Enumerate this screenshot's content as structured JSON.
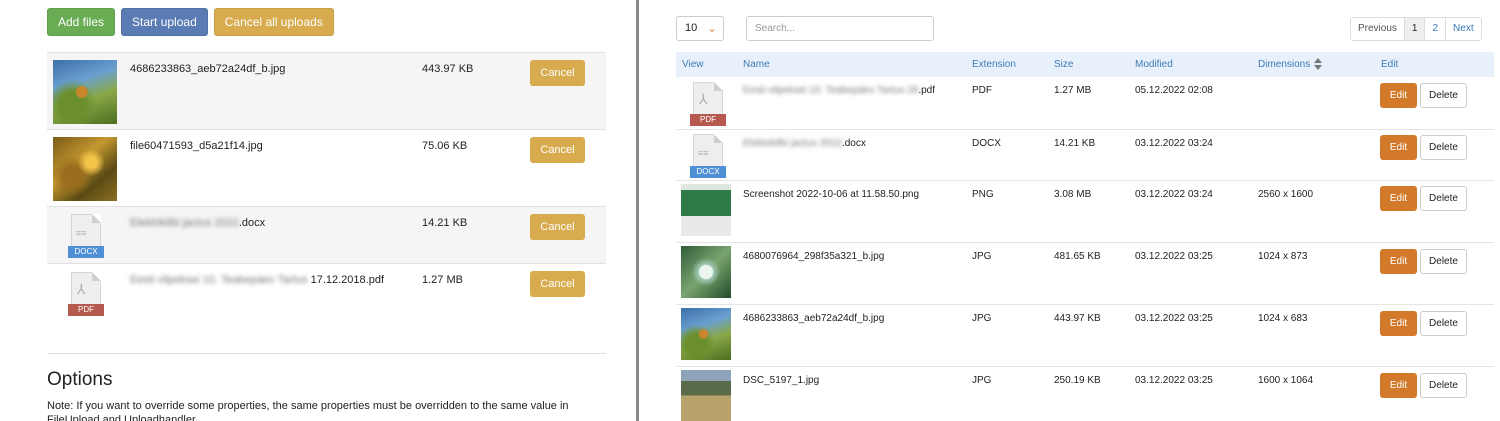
{
  "upload_panel": {
    "buttons": {
      "add_files": "Add files",
      "start_upload": "Start upload",
      "cancel_all": "Cancel all uploads"
    },
    "files": [
      {
        "name": "4686233863_aeb72a24df_b.jpg",
        "size": "443.97 KB",
        "thumb": "photo-bird"
      },
      {
        "name": "file60471593_d5a21f14.jpg",
        "size": "75.06 KB",
        "thumb": "photo-leaves"
      },
      {
        "name_blurred": "Elektrikilbi jactus 2022",
        "name_visible": ".docx",
        "size": "14.21 KB",
        "thumb": "docx-icon"
      },
      {
        "name_blurred": "Eesti vilpeksei 10. Teabepäev Tartus",
        "name_visible": " 17.12.2018.pdf",
        "size": "1.27 MB",
        "thumb": "pdf-icon"
      }
    ],
    "cancel_label": "Cancel",
    "options_title": "Options",
    "options_note": "Note: If you want to override some properties, the same properties must be overridden to the same value in FileUpload and Uploadhandler."
  },
  "file_table": {
    "page_length": "10",
    "search_placeholder": "Search...",
    "pagination": {
      "previous": "Previous",
      "pages": [
        "1",
        "2"
      ],
      "next": "Next",
      "active_page": "1"
    },
    "columns": {
      "view": "View",
      "name": "Name",
      "extension": "Extension",
      "size": "Size",
      "modified": "Modified",
      "dimensions": "Dimensions",
      "edit": "Edit"
    },
    "rows": [
      {
        "name_blurred": "Eesti vilpeksei 10. Teabepäev Tartus 28",
        "name_visible": ".pdf",
        "extension": "PDF",
        "size": "1.27 MB",
        "modified": "05.12.2022 02:08",
        "dimensions": "",
        "thumb": "pdf-icon"
      },
      {
        "name_blurred": "Elektrikilbi jactus 2022",
        "name_visible": ".docx",
        "extension": "DOCX",
        "size": "14.21 KB",
        "modified": "03.12.2022 03:24",
        "dimensions": "",
        "thumb": "docx-icon"
      },
      {
        "name": "Screenshot 2022-10-06 at 11.58.50.png",
        "extension": "PNG",
        "size": "3.08 MB",
        "modified": "03.12.2022 03:24",
        "dimensions": "2560 x 1600",
        "thumb": "photo-screenshot"
      },
      {
        "name": "4680076964_298f35a321_b.jpg",
        "extension": "JPG",
        "size": "481.65 KB",
        "modified": "03.12.2022 03:25",
        "dimensions": "1024 x 873",
        "thumb": "photo-bubble"
      },
      {
        "name": "4686233863_aeb72a24df_b.jpg",
        "extension": "JPG",
        "size": "443.97 KB",
        "modified": "03.12.2022 03:25",
        "dimensions": "1024 x 683",
        "thumb": "photo-bird"
      },
      {
        "name": "DSC_5197_1.jpg",
        "extension": "JPG",
        "size": "250.19 KB",
        "modified": "03.12.2022 03:25",
        "dimensions": "1600 x 1064",
        "thumb": "photo-dsc"
      }
    ],
    "edit_label": "Edit",
    "delete_label": "Delete",
    "file_icon_labels": {
      "pdf": "PDF",
      "docx": "DOCX"
    }
  },
  "colors": {
    "add_button": "#6aac53",
    "start_button": "#5b7bb4",
    "cancel_button": "#d8ab4f",
    "edit_button": "#d27a2a",
    "table_header_bg": "#e8f1fb",
    "header_text": "#3d7bb5"
  }
}
